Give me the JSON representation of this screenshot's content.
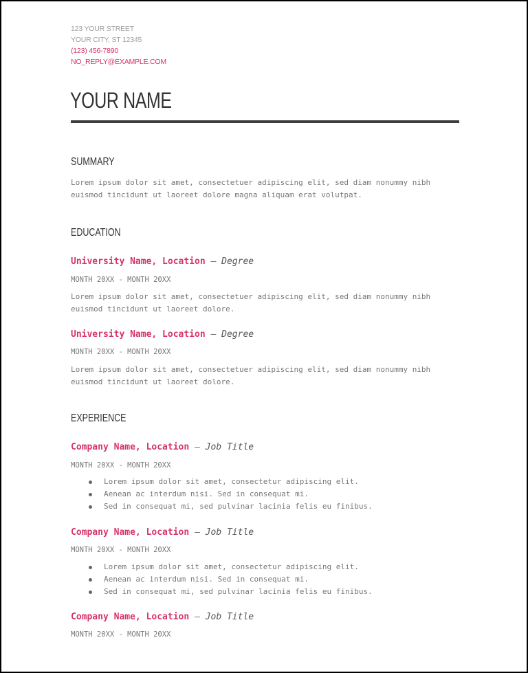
{
  "contact": {
    "street": "123 YOUR STREET",
    "city": "YOUR CITY, ST 12345",
    "phone": "(123) 456-7890",
    "email": "NO_REPLY@EXAMPLE.COM"
  },
  "name": "YOUR NAME",
  "colors": {
    "accent": "#d6336c",
    "heading": "#333333",
    "body_text": "#777777",
    "rule": "#3d3d3d"
  },
  "summary": {
    "title": "SUMMARY",
    "text": "Lorem ipsum dolor sit amet, consectetuer adipiscing elit, sed diam nonummy nibh\neuismod tincidunt ut laoreet dolore magna aliquam erat volutpat."
  },
  "education": {
    "title": "EDUCATION",
    "entries": [
      {
        "org": "University Name, Location",
        "separator": " — ",
        "role": "Degree",
        "dates": "MONTH 20XX - MONTH 20XX",
        "text": "Lorem ipsum dolor sit amet, consectetuer adipiscing elit, sed diam nonummy nibh\neuismod tincidunt ut laoreet dolore."
      },
      {
        "org": "University Name, Location",
        "separator": " — ",
        "role": "Degree",
        "dates": "MONTH 20XX - MONTH 20XX",
        "text": "Lorem ipsum dolor sit amet, consectetuer adipiscing elit, sed diam nonummy nibh\neuismod tincidunt ut laoreet dolore."
      }
    ]
  },
  "experience": {
    "title": "EXPERIENCE",
    "entries": [
      {
        "org": "Company Name, Location",
        "separator": " — ",
        "role": "Job Title",
        "dates": "MONTH 20XX - MONTH 20XX",
        "bullets": [
          "Lorem ipsum dolor sit amet, consectetur adipiscing elit.",
          "Aenean ac interdum nisi. Sed in consequat mi.",
          "Sed in consequat mi, sed pulvinar lacinia felis eu finibus."
        ]
      },
      {
        "org": "Company Name, Location",
        "separator": " — ",
        "role": "Job Title",
        "dates": "MONTH 20XX - MONTH 20XX",
        "bullets": [
          "Lorem ipsum dolor sit amet, consectetur adipiscing elit.",
          "Aenean ac interdum nisi. Sed in consequat mi.",
          "Sed in consequat mi, sed pulvinar lacinia felis eu finibus."
        ]
      },
      {
        "org": "Company Name, Location",
        "separator": " — ",
        "role": "Job Title",
        "dates": "MONTH 20XX - MONTH 20XX",
        "bullets": []
      }
    ]
  }
}
